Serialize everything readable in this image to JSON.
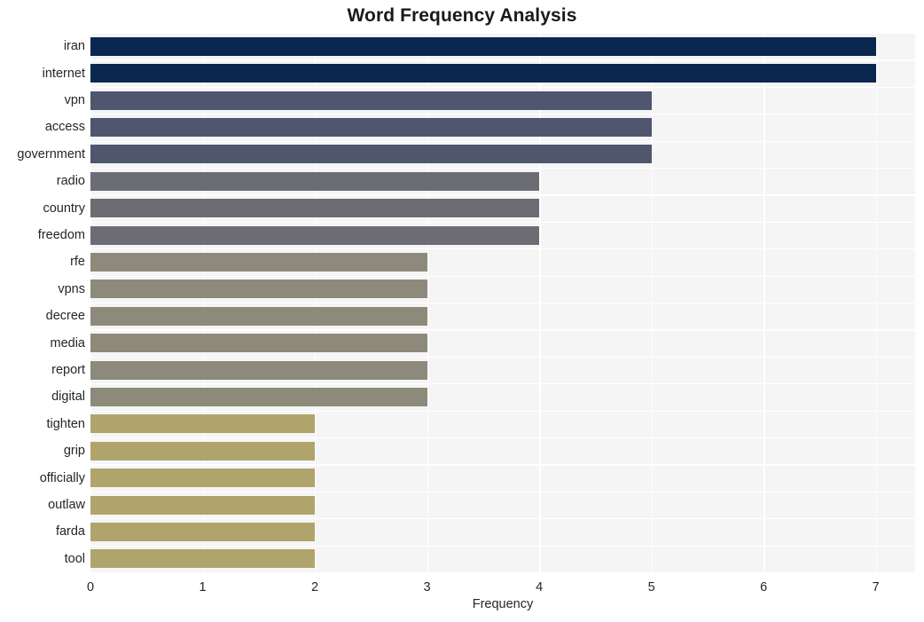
{
  "chart_data": {
    "type": "bar",
    "orientation": "horizontal",
    "title": "Word Frequency Analysis",
    "xlabel": "Frequency",
    "ylabel": "",
    "xlim": [
      0,
      7.35
    ],
    "ylim": [
      0,
      20
    ],
    "grid": true,
    "legend": false,
    "background": "#f5f5f6",
    "gridline_color": "#ffffff",
    "xticks": [
      "0",
      "1",
      "2",
      "3",
      "4",
      "5",
      "6",
      "7"
    ],
    "xtick_values": [
      0,
      1,
      2,
      3,
      4,
      5,
      6,
      7
    ],
    "categories": [
      "iran",
      "internet",
      "vpn",
      "access",
      "government",
      "radio",
      "country",
      "freedom",
      "rfe",
      "vpns",
      "decree",
      "media",
      "report",
      "digital",
      "tighten",
      "grip",
      "officially",
      "outlaw",
      "farda",
      "tool"
    ],
    "values": [
      7,
      7,
      5,
      5,
      5,
      4,
      4,
      4,
      3,
      3,
      3,
      3,
      3,
      3,
      2,
      2,
      2,
      2,
      2,
      2
    ],
    "bar_colors": [
      "#0a2750",
      "#0a2750",
      "#4f566e",
      "#4f566e",
      "#4f566e",
      "#6c6d74",
      "#6c6d74",
      "#6c6d74",
      "#8d8a7b",
      "#8d8a7b",
      "#8d8a7b",
      "#8d8a7b",
      "#8d8a7b",
      "#8d8a7b",
      "#afa56c",
      "#afa56c",
      "#afa56c",
      "#afa56c",
      "#afa56c",
      "#afa56c"
    ],
    "color_legend": {
      "tier_7": "#0a2750",
      "tier_5": "#4f566e",
      "tier_4": "#6c6d74",
      "tier_3": "#8d8a7b",
      "tier_2": "#afa56c"
    }
  }
}
